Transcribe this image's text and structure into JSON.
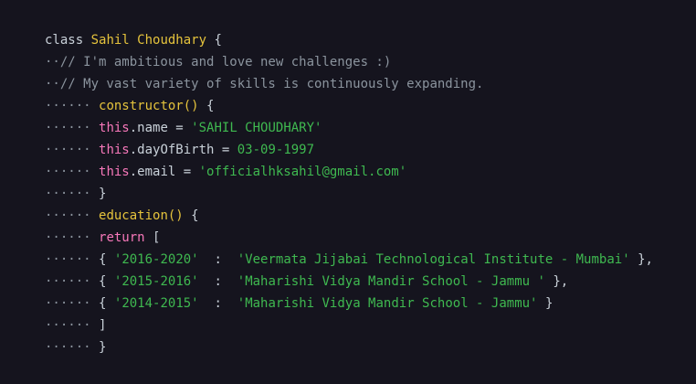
{
  "code": {
    "l1": {
      "kw": "class",
      "name": "Sahil Choudhary",
      "brace": "{"
    },
    "l2": {
      "dots": "··",
      "comment": "// I'm ambitious and love new challenges :)"
    },
    "l3": {
      "dots": "··",
      "comment": "// My vast variety of skills is continuously expanding."
    },
    "l4": {
      "dots": "······",
      "fn": "constructor()",
      "brace": "{"
    },
    "l5": {
      "dots": "······",
      "this": "this",
      "prop": ".name = ",
      "str": "'SAHIL CHOUDHARY'"
    },
    "l6": {
      "dots": "······",
      "this": "this",
      "prop": ".dayOfBirth = ",
      "num": "03-09-1997"
    },
    "l7": {
      "dots": "······",
      "this": "this",
      "prop": ".email = ",
      "str": "'officialhksahil@gmail.com'"
    },
    "l8": {
      "dots": "······",
      "brace": "}"
    },
    "l9": {
      "dots": "······",
      "fn": "education()",
      "brace": "{"
    },
    "l10": {
      "dots": "······",
      "kw": "return",
      "brace": "["
    },
    "l11": {
      "dots": "······",
      "open": "{",
      "year": "'2016-2020'",
      "sep": "  :  ",
      "inst": "'Veermata Jijabai Technological Institute - Mumbai'",
      "close": "},"
    },
    "l12": {
      "dots": "······",
      "open": "{",
      "year": "'2015-2016'",
      "sep": "  :  ",
      "inst": "'Maharishi Vidya Mandir School - Jammu '",
      "close": "},"
    },
    "l13": {
      "dots": "······",
      "open": "{",
      "year": "'2014-2015'",
      "sep": "  :  ",
      "inst": "'Maharishi Vidya Mandir School - Jammu'",
      "close": "}"
    },
    "l14": {
      "dots": "······",
      "brace": "]"
    },
    "l15": {
      "dots": "······",
      "brace": "}"
    }
  }
}
